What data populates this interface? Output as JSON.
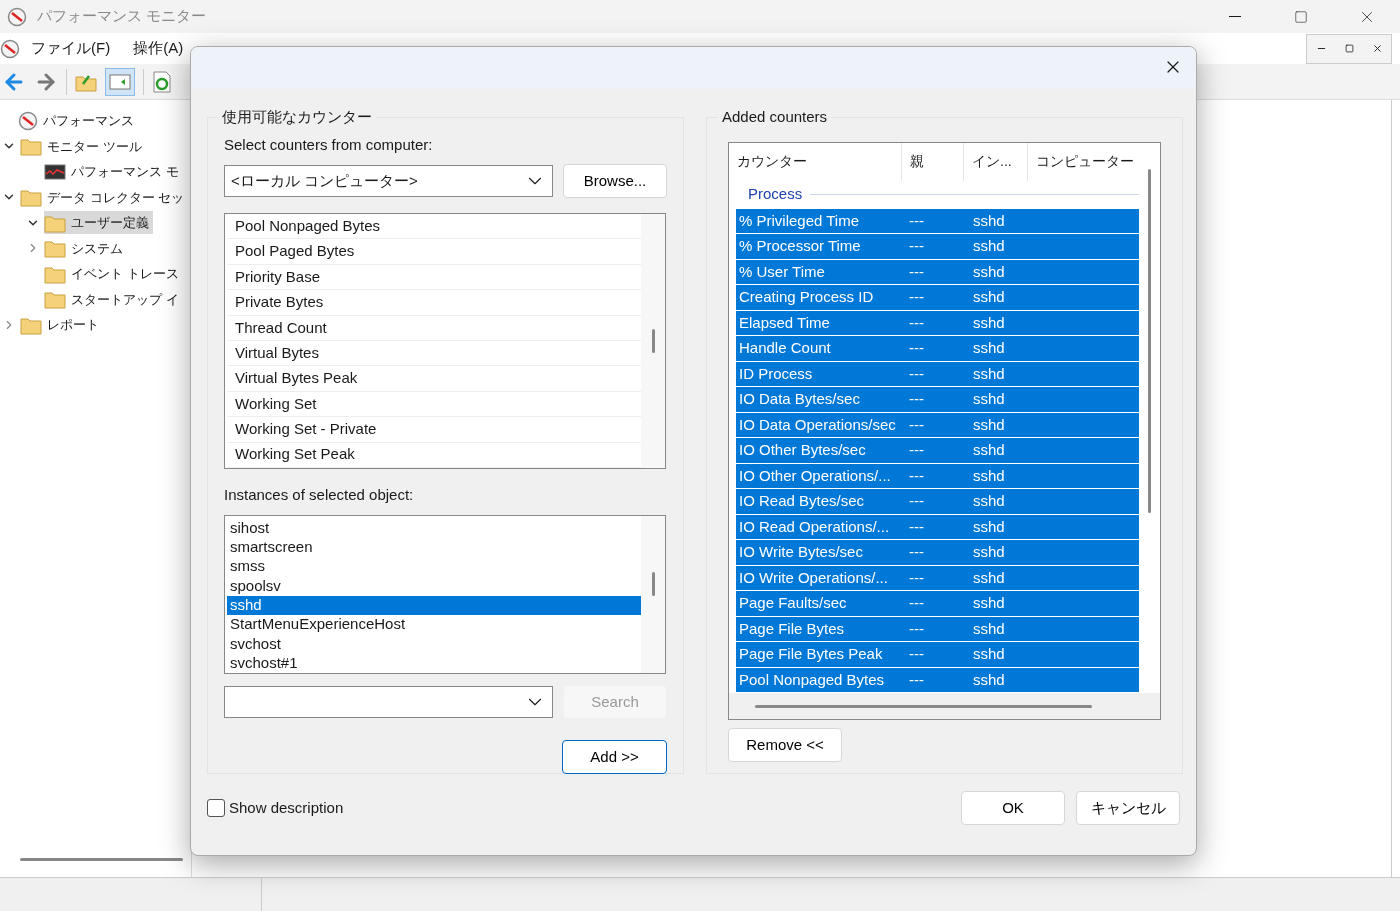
{
  "app": {
    "title": "パフォーマンス モニター",
    "menu": [
      "ファイル(F)",
      "操作(A)"
    ],
    "tree": [
      {
        "label": "パフォーマンス",
        "kind": "root"
      },
      {
        "label": "モニター ツール",
        "kind": "folder",
        "expanded": true,
        "children": [
          {
            "label": "パフォーマンス モ",
            "kind": "graph"
          }
        ]
      },
      {
        "label": "データ コレクター セッ",
        "kind": "folder",
        "expanded": true,
        "children": [
          {
            "label": "ユーザー定義",
            "kind": "folder",
            "expanded": true,
            "selected": true
          },
          {
            "label": "システム",
            "kind": "folder",
            "expanded": false
          },
          {
            "label": "イベント トレース",
            "kind": "folder"
          },
          {
            "label": "スタートアップ イ",
            "kind": "folder"
          }
        ]
      },
      {
        "label": "レポート",
        "kind": "folder",
        "expanded": false
      }
    ]
  },
  "dialog": {
    "available": {
      "title": "使用可能なカウンター",
      "computer_label": "Select counters from computer:",
      "computer_value": "<ローカル コンピューター>",
      "browse": "Browse...",
      "counters": [
        {
          "name": "Pool Nonpaged Bytes",
          "selected": false
        },
        {
          "name": "Pool Paged Bytes",
          "selected": false
        },
        {
          "name": "Priority Base",
          "selected": false
        },
        {
          "name": "Private Bytes",
          "selected": false
        },
        {
          "name": "Thread Count",
          "selected": false
        },
        {
          "name": "Virtual Bytes",
          "selected": false
        },
        {
          "name": "Virtual Bytes Peak",
          "selected": false
        },
        {
          "name": "Working Set",
          "selected": false
        },
        {
          "name": "Working Set - Private",
          "selected": false
        },
        {
          "name": "Working Set Peak",
          "selected": false
        }
      ],
      "instances_label": "Instances of selected object:",
      "instances": [
        {
          "name": "sihost",
          "selected": false
        },
        {
          "name": "smartscreen",
          "selected": false
        },
        {
          "name": "smss",
          "selected": false
        },
        {
          "name": "spoolsv",
          "selected": false
        },
        {
          "name": "sshd",
          "selected": true
        },
        {
          "name": "StartMenuExperienceHost",
          "selected": false
        },
        {
          "name": "svchost",
          "selected": false
        },
        {
          "name": "svchost#1",
          "selected": false
        }
      ],
      "search": {
        "label": "Search",
        "disabled": true
      },
      "add": "Add >>"
    },
    "added": {
      "title": "Added counters",
      "columns": [
        "カウンター",
        "親",
        "イン...",
        "コンピューター"
      ],
      "group": "Process",
      "rows": [
        {
          "counter": "% Privileged Time",
          "parent": "---",
          "instance": "sshd",
          "selected": true
        },
        {
          "counter": "% Processor Time",
          "parent": "---",
          "instance": "sshd",
          "selected": true
        },
        {
          "counter": "% User Time",
          "parent": "---",
          "instance": "sshd",
          "selected": true
        },
        {
          "counter": "Creating Process ID",
          "parent": "---",
          "instance": "sshd",
          "selected": true
        },
        {
          "counter": "Elapsed Time",
          "parent": "---",
          "instance": "sshd",
          "selected": true
        },
        {
          "counter": "Handle Count",
          "parent": "---",
          "instance": "sshd",
          "selected": true
        },
        {
          "counter": "ID Process",
          "parent": "---",
          "instance": "sshd",
          "selected": true
        },
        {
          "counter": "IO Data Bytes/sec",
          "parent": "---",
          "instance": "sshd",
          "selected": true
        },
        {
          "counter": "IO Data Operations/sec",
          "parent": "---",
          "instance": "sshd",
          "selected": true
        },
        {
          "counter": "IO Other Bytes/sec",
          "parent": "---",
          "instance": "sshd",
          "selected": true
        },
        {
          "counter": "IO Other Operations/...",
          "parent": "---",
          "instance": "sshd",
          "selected": true
        },
        {
          "counter": "IO Read Bytes/sec",
          "parent": "---",
          "instance": "sshd",
          "selected": true
        },
        {
          "counter": "IO Read Operations/...",
          "parent": "---",
          "instance": "sshd",
          "selected": true
        },
        {
          "counter": "IO Write Bytes/sec",
          "parent": "---",
          "instance": "sshd",
          "selected": true
        },
        {
          "counter": "IO Write Operations/...",
          "parent": "---",
          "instance": "sshd",
          "selected": true
        },
        {
          "counter": "Page Faults/sec",
          "parent": "---",
          "instance": "sshd",
          "selected": true
        },
        {
          "counter": "Page File Bytes",
          "parent": "---",
          "instance": "sshd",
          "selected": true
        },
        {
          "counter": "Page File Bytes Peak",
          "parent": "---",
          "instance": "sshd",
          "selected": true
        },
        {
          "counter": "Pool Nonpaged Bytes",
          "parent": "---",
          "instance": "sshd",
          "selected": true
        }
      ],
      "remove": "Remove <<"
    },
    "show_description": {
      "label": "Show description",
      "checked": false
    },
    "buttons": [
      "OK",
      "キャンセル"
    ]
  }
}
